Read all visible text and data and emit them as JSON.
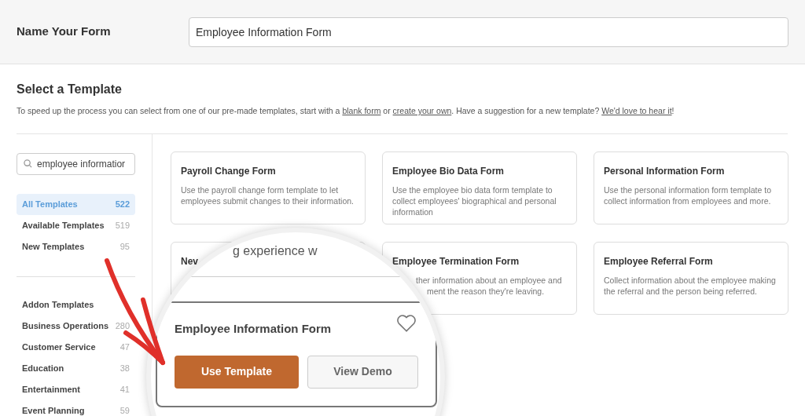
{
  "name_form": {
    "label": "Name Your Form",
    "value": "Employee Information Form"
  },
  "section": {
    "title": "Select a Template",
    "description_parts": [
      {
        "kind": "text",
        "text": "To speed up the process you can select from one of our pre-made templates, start with a "
      },
      {
        "kind": "link",
        "text": "blank form"
      },
      {
        "kind": "text",
        "text": " or "
      },
      {
        "kind": "link",
        "text": "create your own"
      },
      {
        "kind": "text",
        "text": ". Have a suggestion for a new template? "
      },
      {
        "kind": "link",
        "text": "We'd love to hear it"
      },
      {
        "kind": "text",
        "text": "!"
      }
    ]
  },
  "search": {
    "value": "employee informatior"
  },
  "filters": [
    {
      "label": "All Templates",
      "count": "522",
      "selected": true
    },
    {
      "label": "Available Templates",
      "count": "519",
      "selected": false
    },
    {
      "label": "New Templates",
      "count": "95",
      "selected": false
    }
  ],
  "categories": [
    {
      "label": "Addon Templates"
    },
    {
      "label": "Business Operations",
      "count": "280"
    },
    {
      "label": "Customer Service",
      "count": "47"
    },
    {
      "label": "Education",
      "count": "38"
    },
    {
      "label": "Entertainment",
      "count": "41"
    },
    {
      "label": "Event Planning",
      "count": "59"
    }
  ],
  "cards": [
    {
      "title": "Payroll Change Form",
      "description": [
        "Use the payroll change form template to let employees submit changes to their information."
      ]
    },
    {
      "title": "Employee Bio Data Form",
      "description": [
        "Use the employee bio data form template to collect employees' biographical and personal information"
      ]
    },
    {
      "title": "Personal Information Form",
      "description": [
        "Use the personal information form template to collect information from employees and more."
      ]
    },
    {
      "title": "Nev"
    },
    {
      "title": "Employee Termination Form",
      "description": [
        "ther information about an employee and",
        "ment the reason they're leaving."
      ]
    },
    {
      "title": "Employee Referral Form",
      "description": [
        "Collect information about the employee making the referral and the person being referred."
      ]
    }
  ],
  "magnifier": {
    "caption": "g experience w",
    "card_title": "Employee Information Form",
    "favorite": false,
    "buttons": [
      {
        "label": "Use Template",
        "kind": "primary"
      },
      {
        "label": "View Demo",
        "kind": "secondary"
      }
    ]
  }
}
